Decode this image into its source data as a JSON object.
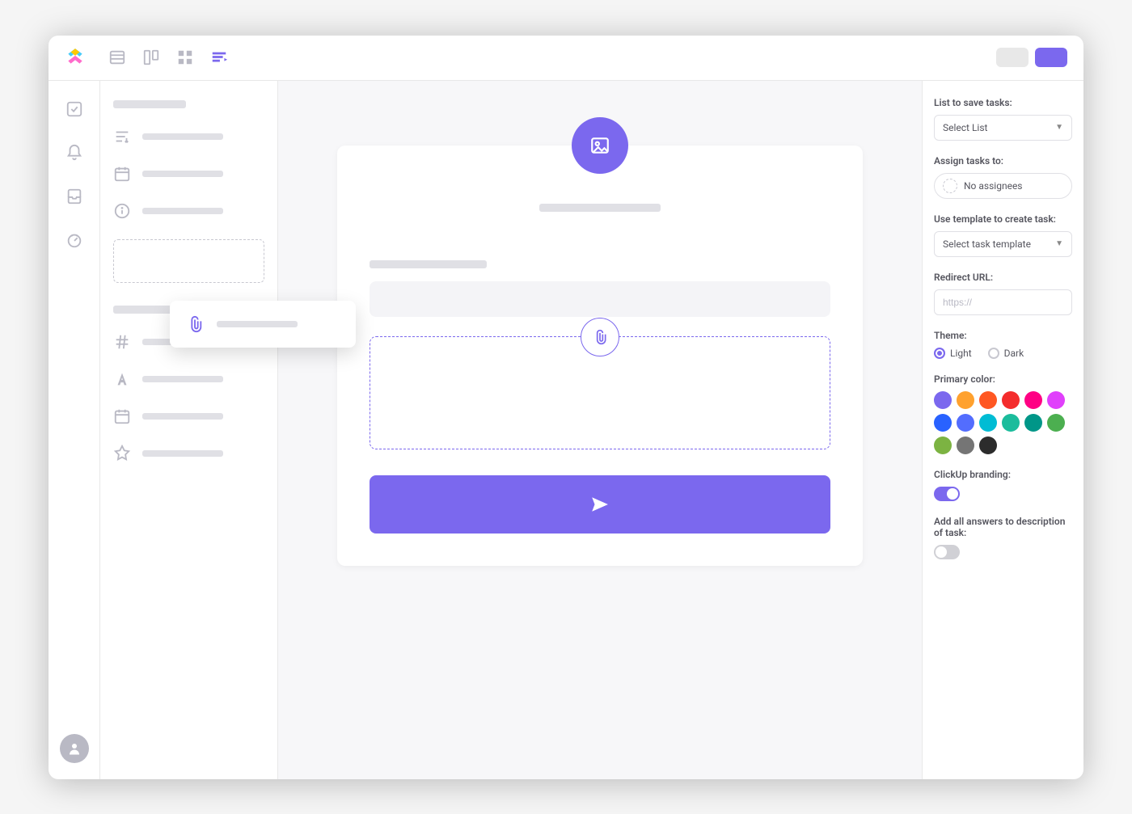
{
  "settings": {
    "list_label": "List to save tasks:",
    "list_value": "Select List",
    "assign_label": "Assign tasks to:",
    "assign_value": "No assignees",
    "template_label": "Use template to create task:",
    "template_value": "Select task template",
    "redirect_label": "Redirect URL:",
    "redirect_placeholder": "https://",
    "theme_label": "Theme:",
    "theme_light": "Light",
    "theme_dark": "Dark",
    "theme_value": "light",
    "primary_label": "Primary color:",
    "primary_selected": "#7b68ee",
    "colors": [
      "#7b68ee",
      "#ffa12e",
      "#ff5722",
      "#f42c2c",
      "#ff0084",
      "#e040fb",
      "#2962ff",
      "#536dfe",
      "#00bcd4",
      "#1bbc9c",
      "#009688",
      "#4caf50",
      "#7cb342",
      "#757575",
      "#2c2c2c"
    ],
    "branding_label": "ClickUp branding:",
    "branding_on": true,
    "answers_label": "Add all answers to description of task:",
    "answers_on": false
  }
}
